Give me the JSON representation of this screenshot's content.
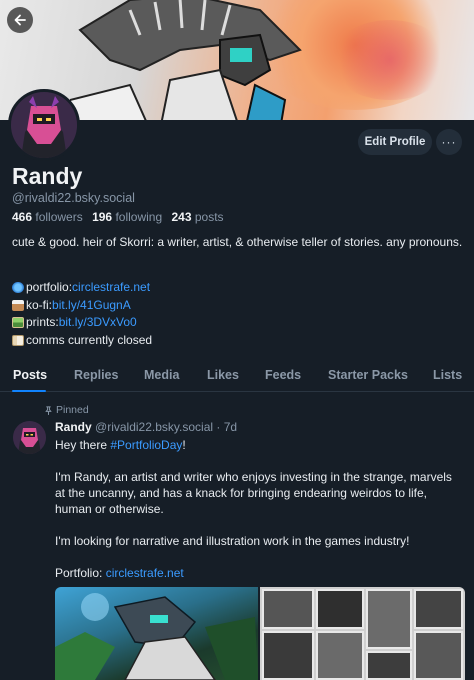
{
  "header": {
    "back_icon": "arrow-left-icon"
  },
  "profile": {
    "name": "Randy",
    "handle": "@rivaldi22.bsky.social",
    "followers_count": "466",
    "followers_label": "followers",
    "following_count": "196",
    "following_label": "following",
    "posts_count": "243",
    "posts_label": "posts",
    "bio": "cute & good. heir of Skorri: a writer, artist, & otherwise teller of stories. any pronouns.",
    "links": [
      {
        "icon": "globe-icon",
        "prefix": "portfolio: ",
        "link": "circlestrafe.net"
      },
      {
        "icon": "coffee-icon",
        "prefix": "ko-fi: ",
        "link": "bit.ly/41GugnA"
      },
      {
        "icon": "picture-icon",
        "prefix": "prints: ",
        "link": "bit.ly/3DVxVo0"
      },
      {
        "icon": "id-card-icon",
        "prefix": "comms currently closed",
        "link": ""
      }
    ],
    "edit_label": "Edit Profile",
    "more_label": "···"
  },
  "tabs": [
    "Posts",
    "Replies",
    "Media",
    "Likes",
    "Feeds",
    "Starter Packs",
    "Lists"
  ],
  "active_tab": "Posts",
  "post": {
    "pinned_label": "Pinned",
    "author": "Randy",
    "handle": "@rivaldi22.bsky.social",
    "time": "· 7d",
    "line1_prefix": "Hey there ",
    "line1_hashtag": "#PortfolioDay",
    "line1_suffix": "!",
    "para2": "I'm Randy, an artist and writer who enjoys investing in the strange, marvels at the uncanny, and has a knack for bringing endearing weirdos to life, human or otherwise.",
    "para3": "I'm looking for narrative and illustration work in the games industry!",
    "para4_prefix": "Portfolio: ",
    "para4_link": "circlestrafe.net"
  },
  "colors": {
    "background": "#161e27",
    "link": "#3b9bff",
    "accent": "#1083fe",
    "muted": "#8796a7"
  }
}
